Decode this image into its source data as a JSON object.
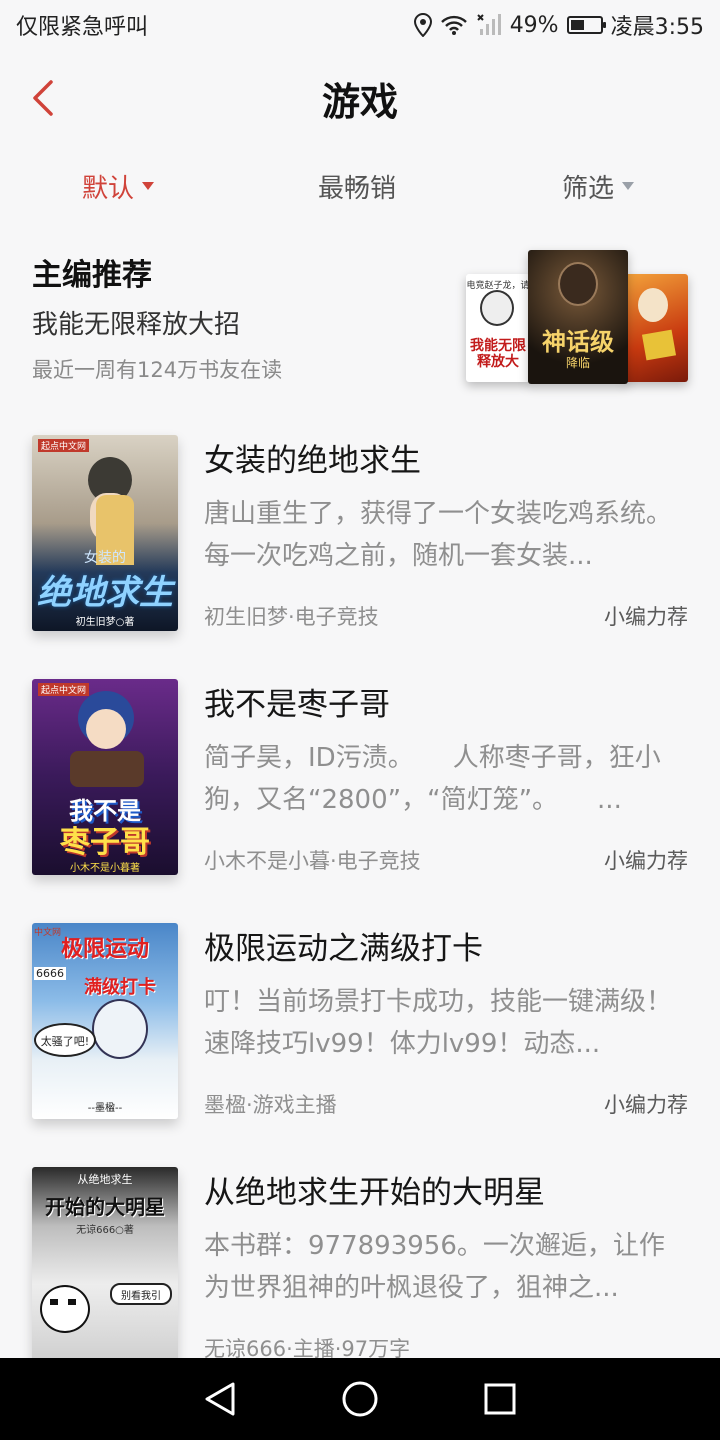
{
  "status_bar": {
    "carrier": "仅限紧急呼叫",
    "battery": "49%",
    "battery_level": 0.49,
    "time": "凌晨3:55"
  },
  "header": {
    "title": "游戏"
  },
  "tabs": [
    {
      "label": "默认",
      "active": true
    },
    {
      "label": "最畅销",
      "active": false
    },
    {
      "label": "筛选",
      "active": false
    }
  ],
  "editor_pick": {
    "heading": "主编推荐",
    "book": "我能无限释放大招",
    "readers": "最近一周有124万书友在读",
    "covers": {
      "left": {
        "top_text": "电竞赵子龙，请",
        "main_text": "我能无限释放大"
      },
      "center": {
        "main_text": "神话级",
        "sub_text": "降临"
      },
      "right": {}
    }
  },
  "books": [
    {
      "title": "女装的绝地求生",
      "desc": "唐山重生了，获得了一个女装吃鸡系统。每一次吃鸡之前，随机一套女装...",
      "meta": "初生旧梦·电子竞技",
      "tag": "小编力荐",
      "cover": {
        "top_text": "起点中文网",
        "main_text": "绝地求生",
        "small_text": "女装的",
        "author": "初生旧梦○著"
      }
    },
    {
      "title": "我不是枣子哥",
      "desc": "简子昊，ID污渍。　　人称枣子哥，狂小狗，又名“2800”，“简灯笼”。　　...",
      "meta": "小木不是小暮·电子竞技",
      "tag": "小编力荐",
      "cover": {
        "top_text": "起点中文网",
        "line1": "我不是",
        "line2": "枣子哥",
        "author": "小木不是小暮著"
      }
    },
    {
      "title": "极限运动之满级打卡",
      "desc": "叮！当前场景打卡成功，技能一键满级！速降技巧lv99！体力lv99！动态...",
      "meta": "墨楹·游戏主播",
      "tag": "小编力荐",
      "cover": {
        "top_text": "中文网",
        "line1": "极限运动",
        "line2": "满级打卡",
        "bubble": "太骚了吧!",
        "num": "6666",
        "author": "--墨楹--"
      }
    },
    {
      "title": "从绝地求生开始的大明星",
      "desc": "本书群：977893956。一次邂逅，让作为世界狙神的叶枫退役了，狙神之...",
      "meta": "无谅666·主播·97万字",
      "tag": "",
      "cover": {
        "top_text": "从绝地求生",
        "main_text": "开始的大明星",
        "author": "无谅666○著",
        "bubble": "别看我引"
      }
    }
  ],
  "colors": {
    "accent": "#d0433a",
    "background": "#f7f7f8",
    "muted_text": "#8f8f8f"
  },
  "nav": {
    "back": "back-icon",
    "home": "home-icon",
    "recents": "recents-icon"
  }
}
